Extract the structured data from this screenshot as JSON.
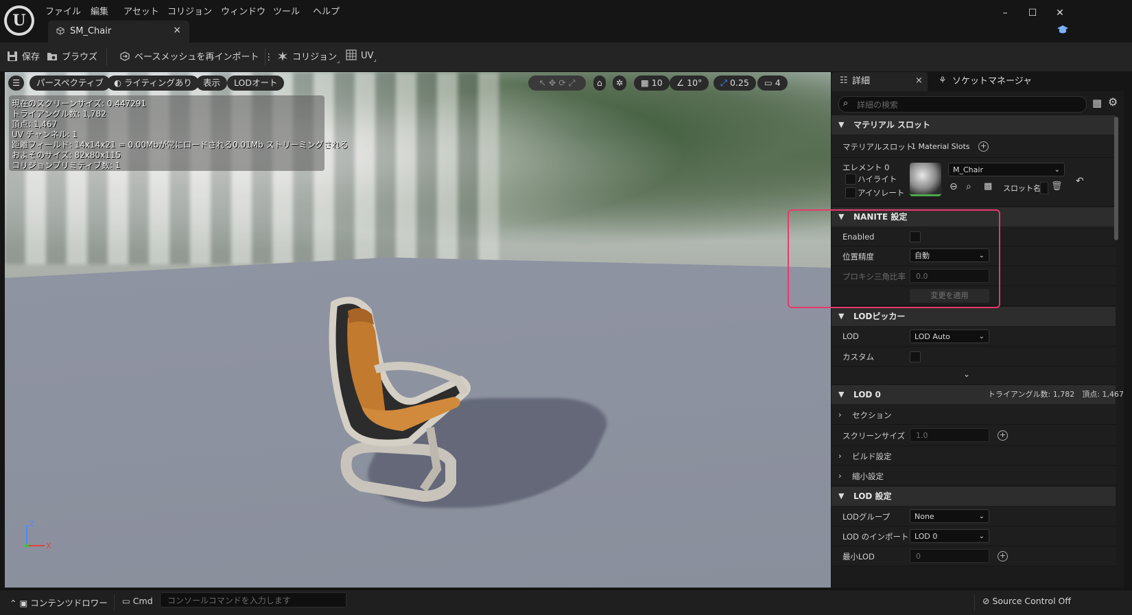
{
  "menu": [
    "ファイル",
    "編集",
    "アセット",
    "コリジョン",
    "ウィンドウ",
    "ツール",
    "ヘルプ"
  ],
  "tab": {
    "label": "SM_Chair"
  },
  "toolbar": {
    "save": "保存",
    "browse": "ブラウズ",
    "reimport": "ベースメッシュを再インポート",
    "collision": "コリジョン",
    "uv": "UV"
  },
  "viewport": {
    "buttons": [
      "パースペクティブ",
      "ライティングあり",
      "表示",
      "LODオート"
    ],
    "grid_snap": "10",
    "angle_snap": "10°",
    "scale_snap": "0.25",
    "camera_speed": "4",
    "stats": [
      "現在のスクリーンサイズ: 0.447291",
      "トライアングル数: 1,782",
      "頂点: 1,467",
      "UV チャンネル: 1",
      "距離フィールド: 14x14x21 = 0.00Mbが常にロードされる0.01Mb ストリーミングされる",
      "およそのサイズ: 82x80x115",
      "コリジョンプリミティブ数: 1"
    ],
    "axis": {
      "z": "Z",
      "x": "X"
    }
  },
  "details": {
    "tab_details": "詳細",
    "tab_socket": "ソケットマネージャ",
    "search_placeholder": "詳細の検索",
    "material_section": "マテリアル スロット",
    "material_slots_label": "マテリアルスロット",
    "material_slots_value": "1 Material Slots",
    "element_label": "エレメント 0",
    "highlight_label": "ハイライト",
    "isolate_label": "アイソレート",
    "material_name": "M_Chair",
    "slot_name_label": "スロット名",
    "nanite_section": "NANITE 設定",
    "nanite_enabled": "Enabled",
    "position_precision": "位置精度",
    "position_precision_value": "自動",
    "proxy_ratio": "プロキシ三角比率",
    "proxy_ratio_value": "0.0",
    "apply_changes": "変更を適用",
    "lod_picker_section": "LODピッカー",
    "lod_label": "LOD",
    "lod_value": "LOD Auto",
    "custom_label": "カスタム",
    "lod0_section": "LOD 0",
    "lod0_stats": "トライアングル数: 1,782　頂点: 1,467",
    "sections_label": "セクション",
    "screen_size_label": "スクリーンサイズ",
    "screen_size_value": "1.0",
    "build_settings_label": "ビルド設定",
    "reduction_label": "縮小設定",
    "lod_settings_section": "LOD 設定",
    "lod_group_label": "LODグループ",
    "lod_group_value": "None",
    "lod_import_label": "LOD のインポート",
    "lod_import_value": "LOD 0",
    "min_lod_label": "最小LOD",
    "min_lod_value": "0"
  },
  "bottom": {
    "content_drawer": "コンテンツドロワー",
    "cmd": "Cmd",
    "console_placeholder": "コンソールコマンドを入力します",
    "source_control": "Source Control Off"
  },
  "colors": {
    "highlight": "#e8386d",
    "accent": "#4a8cff"
  }
}
